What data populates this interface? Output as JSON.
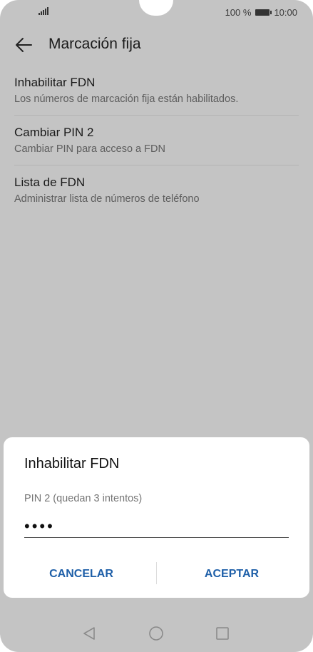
{
  "status_bar": {
    "battery_text": "100 %",
    "time": "10:00",
    "icons": [
      "signal-icon",
      "battery-icon"
    ]
  },
  "app_bar": {
    "back_icon": "arrow-left-icon",
    "title": "Marcación fija"
  },
  "settings": {
    "items": [
      {
        "title": "Inhabilitar FDN",
        "subtitle": "Los números de marcación fija están habilitados."
      },
      {
        "title": "Cambiar PIN 2",
        "subtitle": "Cambiar PIN para acceso a FDN"
      },
      {
        "title": "Lista de FDN",
        "subtitle": "Administrar lista de números de teléfono"
      }
    ]
  },
  "dialog": {
    "title": "Inhabilitar FDN",
    "field_label": "PIN 2 (quedan 3 intentos)",
    "pin_value": "••••",
    "cancel_label": "CANCELAR",
    "accept_label": "ACEPTAR",
    "accent_color": "#1e5fa8"
  },
  "nav_bar": {
    "icons": [
      "back-triangle-icon",
      "home-circle-icon",
      "recents-square-icon"
    ]
  },
  "colors": {
    "scrim_background": "#c4c4c4",
    "dialog_background": "#ffffff"
  }
}
